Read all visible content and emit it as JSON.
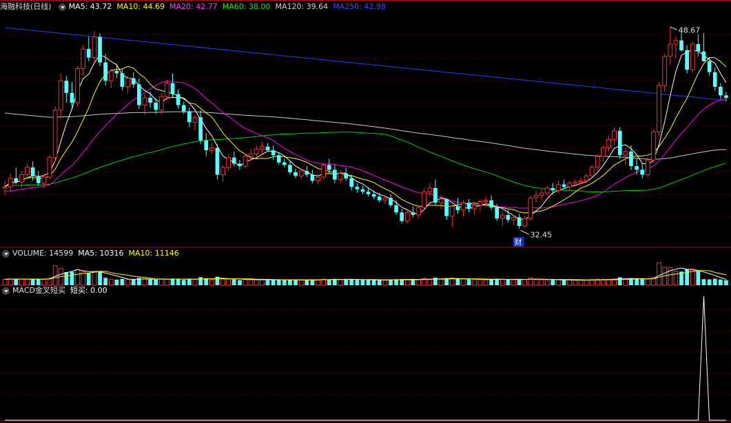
{
  "title": "海融科技(日线)",
  "price_panel": {
    "ma5_label": "MA5: 43.72",
    "ma10_label": "MA10: 44.69",
    "ma20_label": "MA20: 42.77",
    "ma60_label": "MA60: 38.00",
    "ma120_label": "MA120: 39.64",
    "ma250_label": "MA250: 42.98",
    "high_label": "48.67",
    "low_label": "32.45",
    "event_marker": "财",
    "colors": {
      "ma5": "#ffffff",
      "ma10": "#ffff00",
      "ma20": "#ff00ff",
      "ma60": "#00d000",
      "ma120": "#c8c8c8",
      "ma250": "#2040ff",
      "up": "#ff3030",
      "down": "#54ffff"
    }
  },
  "volume_panel": {
    "volume_label": "VOLUME: 14599",
    "ma5_label": "MA5: 10316",
    "ma10_label": "MA10: 11146"
  },
  "macd_panel": {
    "label": "MACD金叉短买",
    "value_label": "短买: 0.00"
  },
  "chart_data": [
    {
      "type": "candlestick",
      "title": "海融科技(日线)",
      "note": "approximate daily OHLC read from the chart",
      "candles": [
        [
          35.8,
          36.4,
          35.2,
          35.9
        ],
        [
          35.9,
          37.0,
          35.5,
          36.6
        ],
        [
          36.6,
          37.5,
          36.1,
          36.3
        ],
        [
          36.3,
          37.2,
          35.8,
          36.9
        ],
        [
          36.9,
          37.8,
          36.5,
          37.5
        ],
        [
          37.5,
          38.0,
          36.4,
          36.8
        ],
        [
          36.8,
          37.2,
          36.0,
          36.2
        ],
        [
          36.2,
          37.0,
          35.8,
          36.7
        ],
        [
          36.7,
          38.5,
          36.5,
          38.3
        ],
        [
          38.3,
          42.5,
          38.0,
          42.2
        ],
        [
          42.2,
          45.2,
          41.5,
          44.6
        ],
        [
          44.6,
          45.0,
          42.8,
          43.6
        ],
        [
          43.6,
          44.5,
          42.2,
          42.8
        ],
        [
          42.8,
          45.8,
          42.5,
          45.6
        ],
        [
          45.6,
          47.5,
          45.0,
          47.2
        ],
        [
          47.2,
          48.2,
          46.2,
          46.5
        ],
        [
          46.5,
          48.67,
          46.0,
          48.2
        ],
        [
          48.2,
          48.5,
          45.8,
          46.1
        ],
        [
          46.1,
          46.8,
          44.2,
          44.6
        ],
        [
          44.6,
          45.6,
          44.0,
          45.4
        ],
        [
          45.4,
          46.0,
          44.8,
          45.2
        ],
        [
          45.2,
          45.6,
          43.8,
          44.1
        ],
        [
          44.1,
          45.0,
          43.6,
          44.8
        ],
        [
          44.8,
          45.3,
          44.0,
          44.3
        ],
        [
          44.3,
          44.8,
          42.3,
          42.6
        ],
        [
          42.6,
          43.5,
          41.8,
          43.2
        ],
        [
          43.2,
          43.7,
          42.4,
          42.8
        ],
        [
          42.8,
          43.2,
          41.9,
          42.2
        ],
        [
          42.2,
          43.6,
          41.9,
          43.3
        ],
        [
          43.3,
          44.7,
          43.0,
          44.4
        ],
        [
          44.4,
          45.2,
          43.2,
          43.5
        ],
        [
          43.5,
          43.9,
          42.3,
          42.6
        ],
        [
          42.6,
          42.9,
          41.9,
          42.1
        ],
        [
          42.1,
          42.4,
          40.8,
          41.2
        ],
        [
          41.2,
          41.8,
          40.5,
          41.6
        ],
        [
          41.6,
          42.2,
          39.4,
          39.7
        ],
        [
          39.7,
          40.3,
          38.4,
          38.9
        ],
        [
          38.9,
          39.5,
          38.6,
          39.1
        ],
        [
          39.1,
          39.4,
          36.5,
          36.9
        ],
        [
          36.9,
          37.7,
          36.3,
          37.5
        ],
        [
          37.5,
          38.6,
          37.2,
          38.3
        ],
        [
          38.3,
          38.8,
          37.6,
          37.8
        ],
        [
          37.8,
          38.1,
          37.3,
          37.6
        ],
        [
          37.6,
          38.6,
          37.4,
          38.4
        ],
        [
          38.4,
          39.0,
          38.0,
          38.6
        ],
        [
          38.6,
          39.3,
          38.3,
          39.0
        ],
        [
          39.0,
          39.6,
          38.5,
          39.2
        ],
        [
          39.2,
          39.5,
          38.8,
          38.9
        ],
        [
          38.9,
          39.3,
          38.1,
          38.5
        ],
        [
          38.5,
          38.7,
          37.7,
          37.9
        ],
        [
          37.9,
          38.2,
          37.5,
          37.7
        ],
        [
          37.7,
          38.0,
          36.9,
          37.1
        ],
        [
          37.1,
          37.4,
          36.6,
          36.8
        ],
        [
          36.8,
          37.4,
          36.5,
          37.2
        ],
        [
          37.2,
          37.6,
          36.7,
          36.9
        ],
        [
          36.9,
          37.3,
          36.2,
          36.4
        ],
        [
          36.4,
          36.9,
          36.1,
          36.7
        ],
        [
          36.7,
          37.9,
          36.5,
          37.7
        ],
        [
          37.7,
          38.2,
          37.0,
          37.3
        ],
        [
          37.3,
          37.7,
          36.2,
          36.5
        ],
        [
          36.5,
          37.3,
          36.2,
          37.0
        ],
        [
          37.0,
          37.5,
          36.4,
          36.6
        ],
        [
          36.6,
          36.9,
          35.6,
          35.9
        ],
        [
          35.9,
          36.2,
          35.4,
          35.7
        ],
        [
          35.7,
          36.0,
          35.3,
          35.5
        ],
        [
          35.5,
          35.8,
          35.1,
          35.3
        ],
        [
          35.3,
          35.6,
          34.9,
          35.1
        ],
        [
          35.1,
          35.4,
          34.6,
          34.8
        ],
        [
          34.8,
          35.2,
          34.5,
          35.0
        ],
        [
          35.0,
          35.3,
          34.2,
          34.4
        ],
        [
          34.4,
          34.8,
          33.6,
          33.8
        ],
        [
          33.8,
          34.1,
          32.9,
          33.1
        ],
        [
          33.1,
          34.0,
          32.9,
          33.8
        ],
        [
          33.8,
          34.3,
          33.4,
          33.6
        ],
        [
          33.6,
          34.4,
          33.3,
          34.2
        ],
        [
          34.2,
          35.8,
          34.0,
          35.5
        ],
        [
          35.5,
          36.2,
          35.1,
          35.8
        ],
        [
          35.8,
          36.5,
          34.4,
          34.6
        ],
        [
          34.6,
          35.2,
          34.1,
          34.9
        ],
        [
          34.9,
          35.0,
          33.2,
          33.5
        ],
        [
          33.5,
          34.5,
          32.6,
          34.3
        ],
        [
          34.3,
          35.0,
          33.7,
          34.0
        ],
        [
          34.0,
          34.8,
          33.5,
          34.6
        ],
        [
          34.6,
          34.9,
          33.8,
          34.1
        ],
        [
          34.1,
          34.6,
          33.6,
          34.4
        ],
        [
          34.4,
          34.9,
          33.9,
          34.7
        ],
        [
          34.7,
          35.1,
          34.3,
          34.8
        ],
        [
          34.8,
          35.2,
          34.0,
          34.2
        ],
        [
          34.2,
          34.5,
          33.1,
          33.3
        ],
        [
          33.3,
          33.9,
          32.7,
          33.6
        ],
        [
          33.6,
          34.0,
          33.0,
          33.2
        ],
        [
          33.2,
          33.6,
          32.8,
          33.4
        ],
        [
          33.4,
          33.7,
          32.45,
          32.7
        ],
        [
          32.7,
          33.5,
          32.5,
          33.3
        ],
        [
          33.3,
          35.2,
          33.1,
          35.0
        ],
        [
          35.0,
          35.6,
          34.6,
          35.2
        ],
        [
          35.2,
          35.7,
          34.8,
          35.4
        ],
        [
          35.4,
          36.0,
          35.2,
          35.8
        ],
        [
          35.8,
          36.2,
          35.3,
          35.6
        ],
        [
          35.6,
          36.4,
          35.4,
          36.1
        ],
        [
          36.1,
          36.5,
          35.7,
          35.9
        ],
        [
          35.9,
          36.4,
          35.6,
          36.2
        ],
        [
          36.2,
          36.5,
          35.9,
          36.3
        ],
        [
          36.3,
          36.7,
          36.0,
          36.4
        ],
        [
          36.4,
          37.0,
          36.2,
          36.8
        ],
        [
          36.8,
          37.7,
          36.6,
          37.5
        ],
        [
          37.5,
          38.6,
          37.2,
          38.4
        ],
        [
          38.4,
          39.3,
          38.0,
          39.1
        ],
        [
          39.1,
          40.1,
          38.8,
          39.8
        ],
        [
          39.8,
          40.8,
          39.3,
          40.5
        ],
        [
          40.5,
          40.8,
          38.2,
          38.5
        ],
        [
          38.5,
          39.1,
          37.7,
          38.8
        ],
        [
          38.8,
          39.3,
          37.3,
          37.6
        ],
        [
          37.6,
          38.2,
          36.9,
          37.3
        ],
        [
          37.3,
          37.8,
          36.6,
          36.9
        ],
        [
          36.9,
          38.3,
          36.7,
          38.1
        ],
        [
          38.1,
          40.6,
          37.9,
          40.4
        ],
        [
          40.4,
          44.5,
          40.1,
          44.2
        ],
        [
          44.2,
          46.8,
          43.7,
          46.6
        ],
        [
          46.6,
          49.0,
          45.9,
          47.6
        ],
        [
          47.6,
          48.2,
          46.4,
          47.9
        ],
        [
          47.9,
          48.6,
          47.0,
          47.1
        ],
        [
          47.1,
          47.5,
          45.2,
          45.5
        ],
        [
          45.5,
          47.8,
          45.3,
          47.6
        ],
        [
          47.6,
          48.4,
          46.6,
          47.0
        ],
        [
          47.0,
          48.5,
          46.8,
          46.2
        ],
        [
          46.2,
          46.5,
          45.0,
          45.3
        ],
        [
          45.3,
          45.7,
          43.8,
          44.1
        ],
        [
          44.1,
          44.4,
          43.1,
          43.4
        ],
        [
          43.4,
          43.7,
          42.9,
          43.2
        ]
      ],
      "ma250": {
        "start": 48.95,
        "end": 42.98
      }
    },
    {
      "type": "bar",
      "title": "VOLUME",
      "note": "approximate daily volume, colour by candle direction",
      "ylim": [
        0,
        40000
      ]
    },
    {
      "type": "line",
      "title": "MACD金叉短买",
      "note": "signal line: 0 everywhere except a single spike of 1 near bar 125",
      "spike_index": 125,
      "spike_value": 1,
      "ylim": [
        0,
        1
      ]
    }
  ]
}
